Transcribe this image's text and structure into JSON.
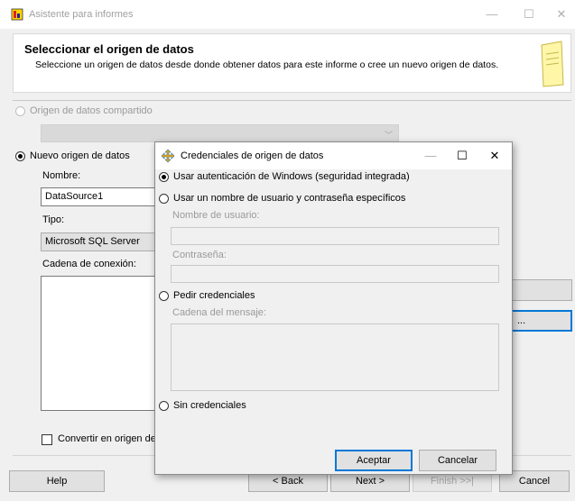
{
  "window": {
    "title": "Asistente para informes"
  },
  "header": {
    "title": "Seleccionar el origen de datos",
    "subtitle": "Seleccione un origen de datos desde donde obtener datos para este informe o cree un nuevo origen de datos."
  },
  "main": {
    "shared_source_label": "Origen de datos compartido",
    "new_source_label": "Nuevo origen de datos",
    "name_label": "Nombre:",
    "name_value": "DataSource1",
    "type_label": "Tipo:",
    "type_value": "Microsoft SQL Server",
    "connection_label": "Cadena de conexión:",
    "edit_button_label": "...",
    "convert_label": "Convertir en origen de d"
  },
  "footer": {
    "help": "Help",
    "back": "< Back",
    "next": "Next >",
    "finish": "Finish >>|",
    "cancel": "Cancel"
  },
  "dialog": {
    "title": "Credenciales de origen de datos",
    "option_windows": "Usar autenticación de Windows (seguridad integrada)",
    "option_specific": "Usar un nombre de usuario y contraseña específicos",
    "username_label": "Nombre de usuario:",
    "password_label": "Contraseña:",
    "option_prompt": "Pedir credenciales",
    "prompt_text_label": "Cadena del mensaje:",
    "option_none": "Sin credenciales",
    "ok": "Aceptar",
    "cancel": "Cancelar"
  },
  "colors": {
    "accent": "#0078d7",
    "header_bg": "#ffffff",
    "window_bg": "#f0f0f0"
  }
}
